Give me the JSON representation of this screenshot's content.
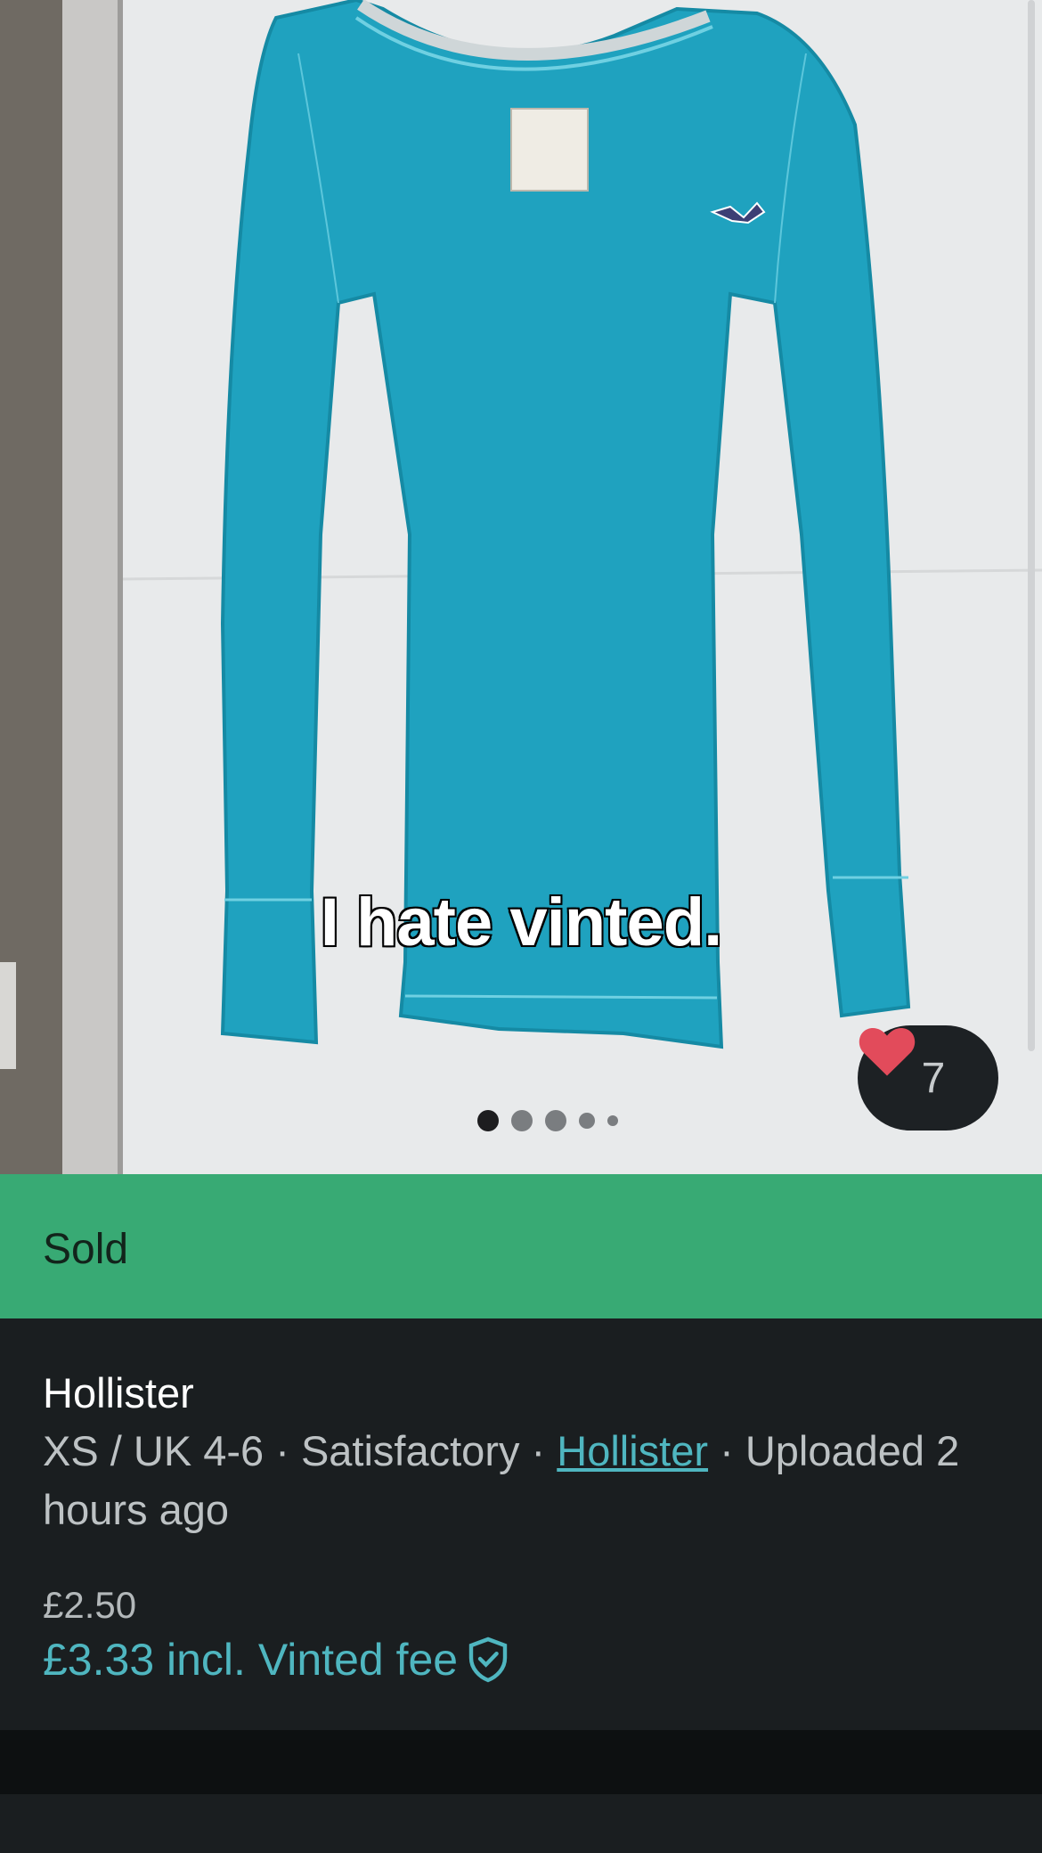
{
  "photo": {
    "caption": "I hate vinted.",
    "carousel_count": 5,
    "active_index": 0,
    "favorites": {
      "count": "7",
      "icon": "heart-icon"
    }
  },
  "status": {
    "label": "Sold",
    "color": "#38aa74"
  },
  "item": {
    "title": "Hollister",
    "size": "XS / UK 4-6",
    "sep": " · ",
    "condition": "Satisfactory",
    "brand_link": "Hollister",
    "uploaded": "Uploaded 2 hours ago",
    "price": "£2.50",
    "price_incl": "£3.33 incl. Vinted fee",
    "fee_icon": "shield-check-icon",
    "accent": "#4fb6c0"
  }
}
